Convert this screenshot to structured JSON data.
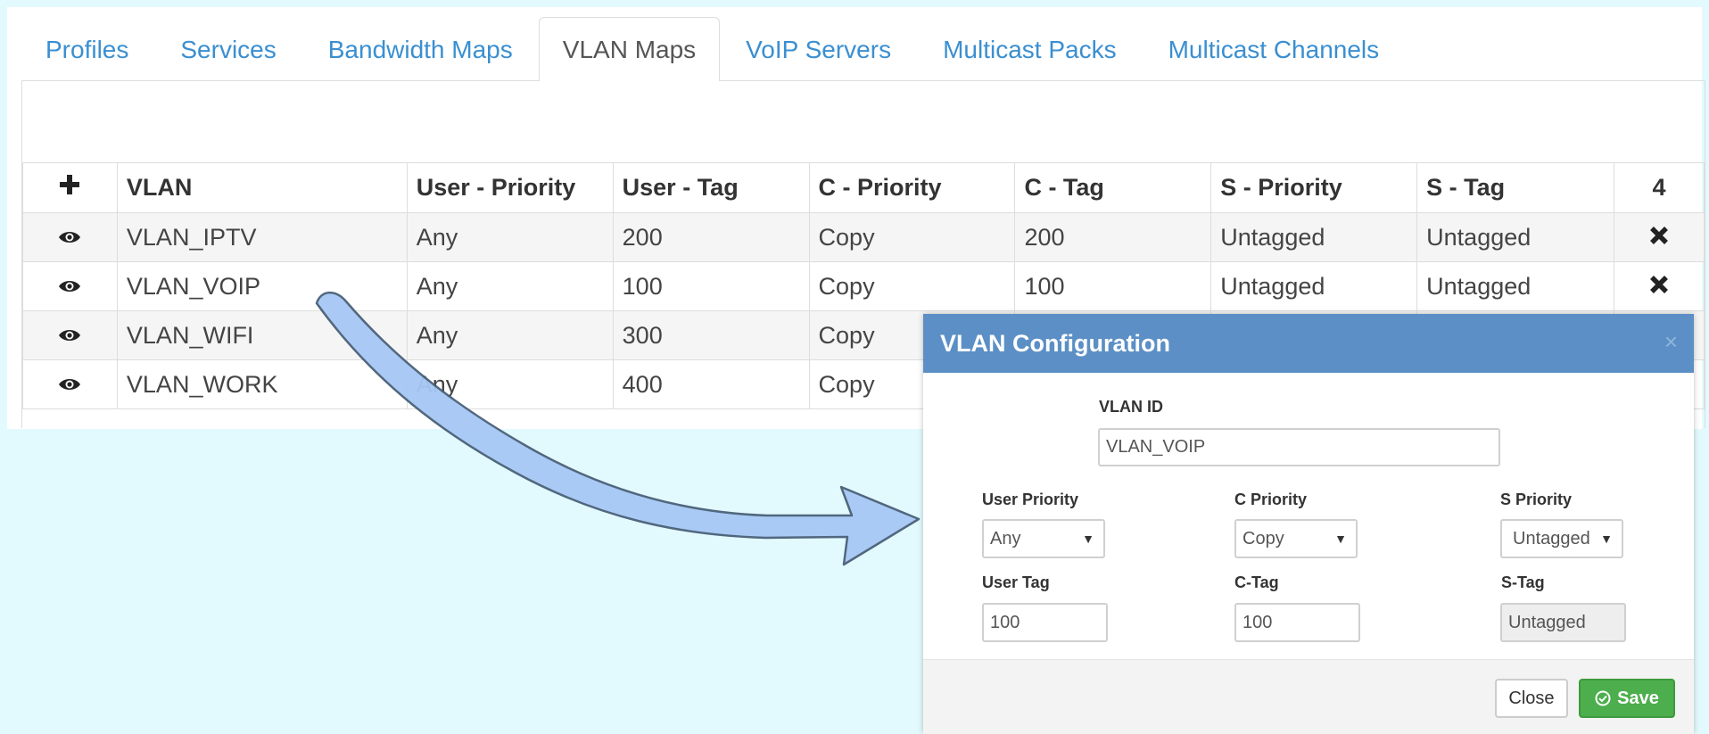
{
  "tabs": [
    {
      "label": "Profiles",
      "active": false
    },
    {
      "label": "Services",
      "active": false
    },
    {
      "label": "Bandwidth Maps",
      "active": false
    },
    {
      "label": "VLAN Maps",
      "active": true
    },
    {
      "label": "VoIP Servers",
      "active": false
    },
    {
      "label": "Multicast Packs",
      "active": false
    },
    {
      "label": "Multicast Channels",
      "active": false
    }
  ],
  "table": {
    "add_icon": "plus-icon",
    "headers": [
      "VLAN",
      "User - Priority",
      "User - Tag",
      "C - Priority",
      "C - Tag",
      "S - Priority",
      "S - Tag"
    ],
    "count": "4",
    "rows": [
      {
        "vlan": "VLAN_IPTV",
        "user_priority": "Any",
        "user_tag": "200",
        "c_priority": "Copy",
        "c_tag": "200",
        "s_priority": "Untagged",
        "s_tag": "Untagged"
      },
      {
        "vlan": "VLAN_VOIP",
        "user_priority": "Any",
        "user_tag": "100",
        "c_priority": "Copy",
        "c_tag": "100",
        "s_priority": "Untagged",
        "s_tag": "Untagged"
      },
      {
        "vlan": "VLAN_WIFI",
        "user_priority": "Any",
        "user_tag": "300",
        "c_priority": "Copy",
        "c_tag": "",
        "s_priority": "",
        "s_tag": ""
      },
      {
        "vlan": "VLAN_WORK",
        "user_priority": "Any",
        "user_tag": "400",
        "c_priority": "Copy",
        "c_tag": "",
        "s_priority": "",
        "s_tag": ""
      }
    ]
  },
  "modal": {
    "title": "VLAN Configuration",
    "close_glyph": "×",
    "vlan_id_label": "VLAN ID",
    "vlan_id_value": "VLAN_VOIP",
    "user_priority_label": "User Priority",
    "user_priority_value": "Any",
    "c_priority_label": "C Priority",
    "c_priority_value": "Copy",
    "s_priority_label": "S Priority",
    "s_priority_value": "Untagged",
    "user_tag_label": "User Tag",
    "user_tag_value": "100",
    "c_tag_label": "C-Tag",
    "c_tag_value": "100",
    "s_tag_label": "S-Tag",
    "s_tag_value": "Untagged",
    "close_button": "Close",
    "save_button": "Save"
  },
  "colors": {
    "background": "#e2fafd",
    "tab_link": "#3a8fd1",
    "modal_header": "#5b8fc5",
    "save_button": "#4cae4c",
    "arrow_fill": "#a6c8f5",
    "arrow_stroke": "#4a6078"
  },
  "icons": {
    "view": "eye-icon",
    "delete": "x-icon",
    "add": "plus-icon",
    "save": "check-circle-icon",
    "select": "chevron-down-icon"
  }
}
